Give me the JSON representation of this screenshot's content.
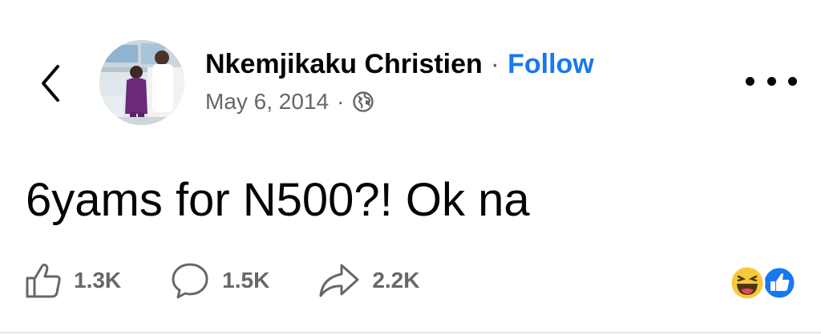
{
  "header": {
    "back_icon": "chevron-left-icon",
    "author_name": "Nkemjikaku Christien",
    "separator": "·",
    "follow_label": "Follow",
    "date": "May 6, 2014",
    "meta_separator": "·",
    "privacy_icon": "globe-icon",
    "more_icon": "ellipsis-icon"
  },
  "post": {
    "text": "6yams for N500?! Ok na"
  },
  "actions": {
    "like": {
      "icon": "thumbs-up-icon",
      "count": "1.3K"
    },
    "comment": {
      "icon": "comment-icon",
      "count": "1.5K"
    },
    "share": {
      "icon": "share-icon",
      "count": "2.2K"
    }
  },
  "reactions": {
    "icons": [
      "laughing-face-icon",
      "like-reaction-icon"
    ],
    "colors": {
      "haha": "#f7c83a",
      "like": "#1877f2"
    }
  },
  "colors": {
    "text_primary": "#050505",
    "text_secondary": "#65676b",
    "link_blue": "#1877f2"
  }
}
